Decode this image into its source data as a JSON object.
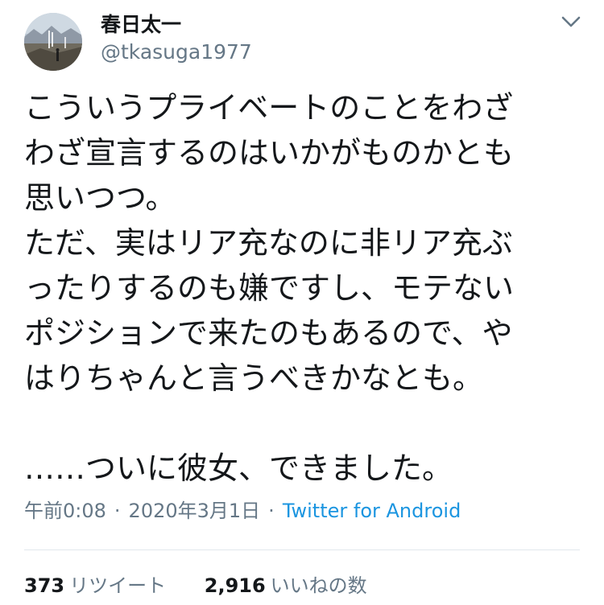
{
  "header": {
    "display_name": "春日太一",
    "handle": "@tkasuga1977",
    "avatar_icon": "profile-photo",
    "menu_icon": "chevron-down-icon"
  },
  "tweet": {
    "lines": [
      "こういうプライベートのことをわざ",
      "わざ宣言するのはいかがものかとも",
      "思いつつ。",
      "ただ、実はリア充なのに非リア充ぶ",
      "ったりするのも嫌ですし、モテない",
      "ポジションで来たのもあるので、や",
      "はりちゃんと言うべきかなとも。",
      "",
      "……ついに彼女、できました。"
    ]
  },
  "meta": {
    "time": "午前0:08",
    "date": "2020年3月1日",
    "separator": "·",
    "source": "Twitter for Android"
  },
  "stats": {
    "retweets_count": "373",
    "retweets_label": "リツイート",
    "likes_count": "2,916",
    "likes_label": "いいねの数"
  },
  "colors": {
    "text": "#14171a",
    "secondary": "#657786",
    "link": "#1b95e0",
    "divider": "#e1e8ed"
  }
}
